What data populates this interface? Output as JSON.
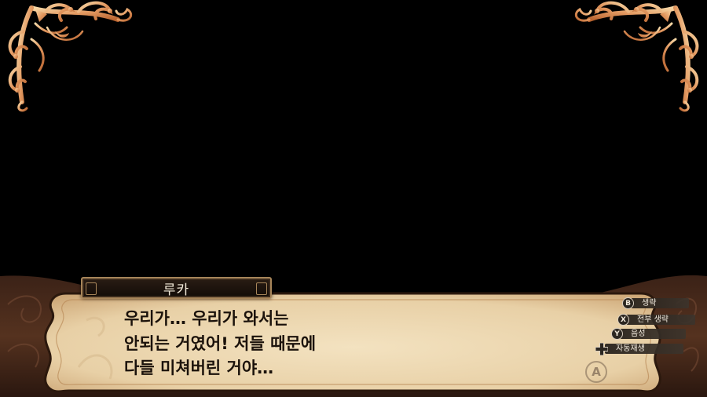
{
  "dialogue": {
    "speaker": "루카",
    "lines": [
      "우리가… 우리가 와서는",
      "안되는 거였어! 저들 때문에",
      "다들 미쳐버린 거야…"
    ]
  },
  "controls": [
    {
      "button": "B",
      "label": "생략"
    },
    {
      "button": "X",
      "label": "전부 생략"
    },
    {
      "button": "Y",
      "label": "음성"
    },
    {
      "button": "dpad",
      "label": "자동재생"
    }
  ],
  "advance_button": {
    "label": "A"
  },
  "colors": {
    "background": "#000000",
    "panel_parchment": "#e9d3ac",
    "ornament_gold": "#e8a46a",
    "text_dark": "#1b120b"
  }
}
